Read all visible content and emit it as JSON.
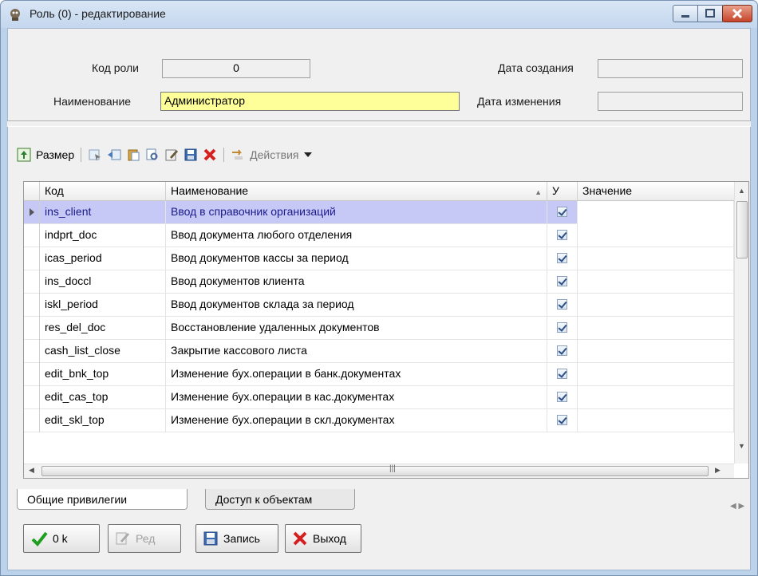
{
  "window": {
    "title": "Роль (0) - редактирование"
  },
  "form": {
    "code_label": "Код роли",
    "code_value": "0",
    "name_label": "Наименование",
    "name_value": "Администратор",
    "created_label": "Дата создания",
    "created_value": "",
    "modified_label": "Дата изменения",
    "modified_value": ""
  },
  "toolbar": {
    "size_label": "Размер",
    "actions_label": "Действия"
  },
  "grid": {
    "columns": [
      "Код",
      "Наименование",
      "У",
      "Значение"
    ],
    "rows": [
      {
        "code": "ins_client",
        "name": "Ввод в справочник организаций",
        "checked": true,
        "value": ""
      },
      {
        "code": "indprt_doc",
        "name": "Ввод документа любого отделения",
        "checked": true,
        "value": ""
      },
      {
        "code": "icas_period",
        "name": "Ввод документов кассы за период",
        "checked": true,
        "value": ""
      },
      {
        "code": "ins_doccl",
        "name": "Ввод документов клиента",
        "checked": true,
        "value": ""
      },
      {
        "code": "iskl_period",
        "name": "Ввод документов склада за период",
        "checked": true,
        "value": ""
      },
      {
        "code": "res_del_doc",
        "name": "Восстановление удаленных документов",
        "checked": true,
        "value": ""
      },
      {
        "code": "cash_list_close",
        "name": "Закрытие кассового листа",
        "checked": true,
        "value": ""
      },
      {
        "code": "edit_bnk_top",
        "name": "Изменение бух.операции в банк.документах",
        "checked": true,
        "value": ""
      },
      {
        "code": "edit_cas_top",
        "name": "Изменение бух.операции в кас.документах",
        "checked": true,
        "value": ""
      },
      {
        "code": "edit_skl_top",
        "name": "Изменение бух.операции в скл.документах",
        "checked": true,
        "value": ""
      }
    ]
  },
  "tabs": [
    "Общие привилегии",
    "Доступ к объектам"
  ],
  "buttons": {
    "ok": "0 k",
    "edit": "Ред",
    "save": "Запись",
    "exit": "Выход"
  },
  "colors": {
    "name_field_bg": "#ffff99",
    "selected_row_bg": "#c6c9f5",
    "close_button": "#c5442a"
  }
}
